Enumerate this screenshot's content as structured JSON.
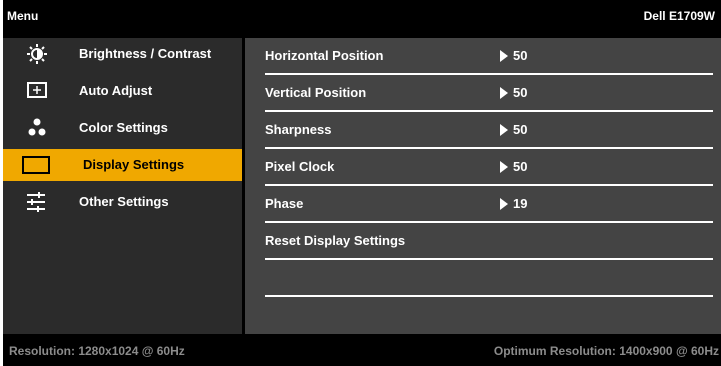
{
  "header": {
    "menu_label": "Menu",
    "model": "Dell E1709W"
  },
  "sidebar": {
    "items": [
      {
        "label": "Brightness / Contrast",
        "icon": "brightness-icon",
        "active": false
      },
      {
        "label": "Auto Adjust",
        "icon": "auto-adjust-icon",
        "active": false
      },
      {
        "label": "Color Settings",
        "icon": "color-settings-icon",
        "active": false
      },
      {
        "label": "Display Settings",
        "icon": "display-settings-icon",
        "active": true
      },
      {
        "label": "Other Settings",
        "icon": "other-settings-icon",
        "active": false
      }
    ]
  },
  "content": {
    "rows": [
      {
        "label": "Horizontal Position",
        "value": "50"
      },
      {
        "label": "Vertical Position",
        "value": "50"
      },
      {
        "label": "Sharpness",
        "value": "50"
      },
      {
        "label": "Pixel Clock",
        "value": "50"
      },
      {
        "label": "Phase",
        "value": "19"
      },
      {
        "label": "Reset Display Settings",
        "value": ""
      }
    ]
  },
  "footer": {
    "resolution": "Resolution: 1280x1024 @ 60Hz",
    "optimum": "Optimum Resolution: 1400x900 @ 60Hz"
  },
  "colors": {
    "highlight": "#f0a800",
    "sidebar_bg": "#2b2b2b",
    "content_bg": "#444444",
    "footer_text": "#8c8c8c"
  }
}
